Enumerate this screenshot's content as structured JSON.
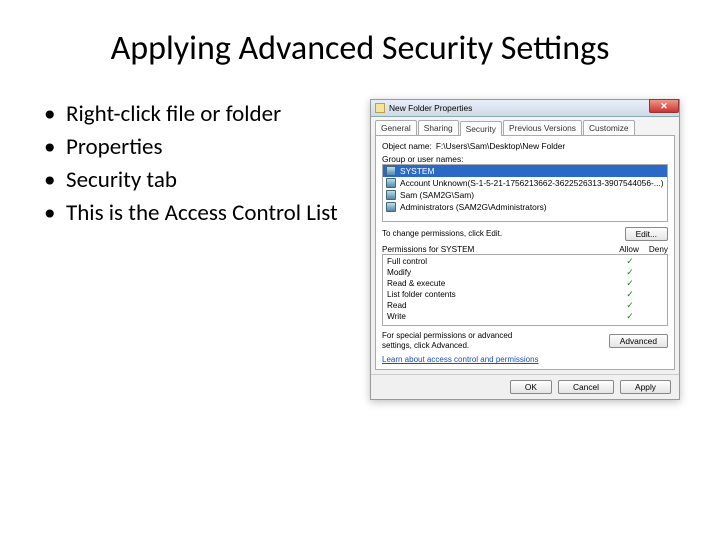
{
  "title": "Applying Advanced Security Settings",
  "bullets": [
    "Right-click file or folder",
    "Properties",
    "Security tab",
    "This is the Access Control List"
  ],
  "win": {
    "title": "New Folder Properties",
    "close": "✕",
    "tabs": [
      "General",
      "Sharing",
      "Security",
      "Previous Versions",
      "Customize"
    ],
    "object_label": "Object name:",
    "object_value": "F:\\Users\\Sam\\Desktop\\New Folder",
    "group_label": "Group or user names:",
    "users": [
      "SYSTEM",
      "Account Unknown(S-1-5-21-1756213662-3622526313-3907544056-...)",
      "Sam (SAM2G\\Sam)",
      "Administrators (SAM2G\\Administrators)"
    ],
    "edit_hint": "To change permissions, click Edit.",
    "edit_btn": "Edit...",
    "perm_label_prefix": "Permissions for ",
    "perm_target": "SYSTEM",
    "allow": "Allow",
    "deny": "Deny",
    "perms": [
      "Full control",
      "Modify",
      "Read & execute",
      "List folder contents",
      "Read",
      "Write"
    ],
    "adv_hint": "For special permissions or advanced settings, click Advanced.",
    "adv_btn": "Advanced",
    "learn_link": "Learn about access control and permissions",
    "ok": "OK",
    "cancel": "Cancel",
    "apply": "Apply"
  }
}
